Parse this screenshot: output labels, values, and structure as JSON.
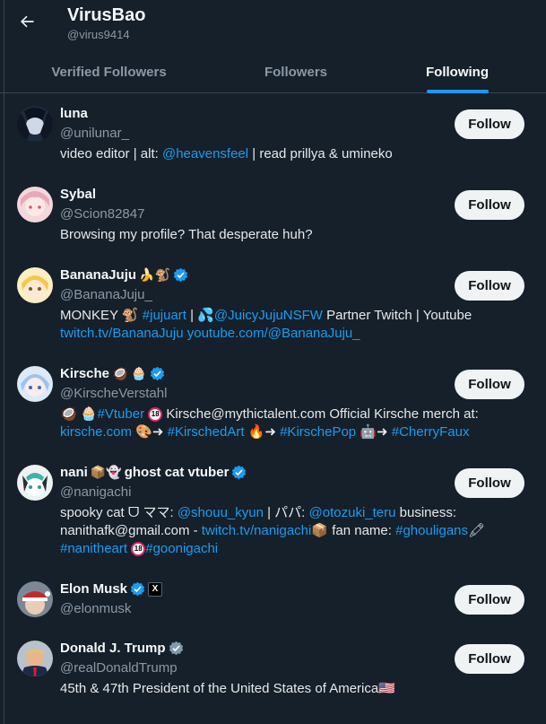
{
  "header": {
    "back_icon": "arrow-left-icon",
    "name": "VirusBao",
    "handle": "@virus9414"
  },
  "tabs": [
    "Verified Followers",
    "Followers",
    "Following"
  ],
  "active_tab": "Following",
  "accent_color": "#1d9bf0",
  "users": [
    {
      "name": "luna",
      "handle": "@unilunar_",
      "follow": "Follow",
      "bio": [
        "video editor | alt: ",
        "@heavensfeel",
        " | read prillya & umineko"
      ]
    },
    {
      "name": "Sybal",
      "handle": "@Scion82847",
      "follow": "Follow",
      "bio": [
        "Browsing my profile? That desperate huh?"
      ]
    },
    {
      "name": "BananaJuju",
      "name_emoji": "🍌🐒",
      "verified": "blue",
      "handle": "@BananaJuju_",
      "follow": "Follow",
      "bio": [
        "MONKEY 🐒 ",
        "#jujuart",
        "  |  💦",
        "@JuicyJujuNSFW",
        " Partner Twitch | Youtube",
        "twitch.tv/BananaJuju",
        "youtube.com/@BananaJuju_"
      ]
    },
    {
      "name": "Kirsche",
      "name_emoji": "🥥 🧁",
      "verified": "blue",
      "handle": "@KirscheVerstahl",
      "follow": "Follow",
      "bio": [
        "🥥 🧁",
        "#Vtuber",
        "18",
        " Kirsche@mythictalent.com Official Kirsche merch at:",
        "kirsche.com",
        " 🎨➜ ",
        "#KirschedArt",
        " 🔥➜ ",
        "#KirschePop",
        " 🤖➜ ",
        "#CherryFaux"
      ]
    },
    {
      "name": "nani",
      "name_emoji": "📦👻",
      "name_suffix": "ghost cat vtuber",
      "verified": "blue",
      "handle": "@nanigachi",
      "follow": "Follow",
      "bio": [
        "spooky cat ᗜ ママ: ",
        "@shouu_kyun",
        " | パパ: ",
        "@otozuki_teru",
        " business: nanithafk@gmail.com - ",
        "twitch.tv/nanigachi",
        "📦 fan name: ",
        "#ghouligans",
        "🖍",
        "#nanitheart",
        "18",
        "#goonigachi"
      ]
    },
    {
      "name": "Elon Musk",
      "verified": "blue",
      "affiliate": "X",
      "handle": "@elonmusk",
      "follow": "Follow",
      "bio": []
    },
    {
      "name": "Donald J. Trump",
      "verified": "gray",
      "handle": "@realDonaldTrump",
      "follow": "Follow",
      "bio": [
        "45th & 47th President of the United States of America🇺🇸"
      ]
    }
  ]
}
